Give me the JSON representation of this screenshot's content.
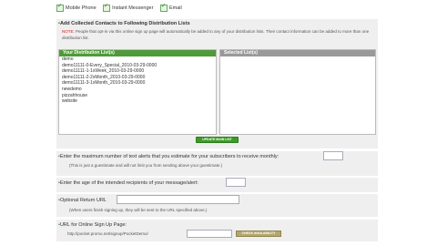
{
  "contact_options": {
    "mobile_phone": "Mobile Phone",
    "instant_messenger": "Instant Messenger",
    "email": "Email"
  },
  "distribution": {
    "heading": "Add Collected Contacts to Following Distribution Lists",
    "note_prefix": "NOTE:",
    "note_text": "People that opt-in via this online sign up page will automatically be added to any of your distribution lists. Their contact information can be added to more than one distribution list.",
    "left_title": "Your Distribution List(s)",
    "right_title": "Selected List(s)",
    "items": [
      "demo",
      "demo11111-0-Every_Special_2010-03-29-0000",
      "demo11111-1-1xWeek_2010-03-29-0000",
      "demo11111-2-2xMonth_2010-03-29-0000",
      "demo11111-3-1xMonth_2010-03-29-0000",
      "newdemo",
      "pizzahhouse",
      "website"
    ],
    "update_button": "UPDATE MAIN LIST"
  },
  "monthly_alerts": {
    "label": "Enter the maximum number of text alerts that you estimate for your subscribers to receive monthly:",
    "hint": "(This is just a guestimate and will not limit you from sending above your guestimate.)",
    "value": ""
  },
  "age": {
    "label": "Enter the age of the intended recipients of your message/alert:",
    "value": ""
  },
  "return_url": {
    "label": "Optional Return URL",
    "hint": "(When users finish signing up, they will be sent to the URL specified above.)",
    "value": ""
  },
  "signup_url": {
    "label": "URL for Online Sign Up Page:",
    "prefix": "http://pocket.promo.net/signup/PocketDemo/",
    "value": "",
    "button": "CHECK AVAILABILITY"
  }
}
